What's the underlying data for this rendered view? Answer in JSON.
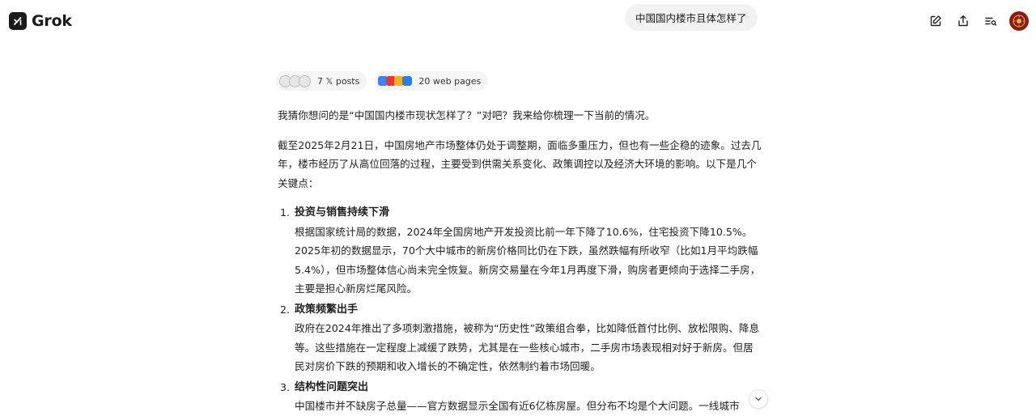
{
  "app": {
    "name": "Grok"
  },
  "query": {
    "text": "中国国内楼市且体怎样了"
  },
  "header": {
    "icons": [
      "new-chat-icon",
      "share-icon",
      "history-icon"
    ]
  },
  "sources": {
    "x_posts_label": "7 𝕏 posts",
    "web_pages_label": "20 web pages"
  },
  "answer": {
    "intro": "我猜你想问的是“中国国内楼市现状怎样了？”对吧？我来给你梳理一下当前的情况。",
    "overview": "截至2025年2月21日，中国房地产市场整体仍处于调整期，面临多重压力，但也有一些企稳的迹象。过去几年，楼市经历了从高位回落的过程，主要受到供需关系变化、政策调控以及经济大环境的影响。以下是几个关键点：",
    "points": [
      {
        "number": "1.",
        "title": "投资与销售持续下滑",
        "body": "根据国家统计局的数据，2024年全国房地产开发投资比前一年下降了10.6%，住宅投资下降10.5%。2025年初的数据显示，70个大中城市的新房价格同比仍在下跌，虽然跌幅有所收窄（比如1月平均跌幅5.4%），但市场整体信心尚未完全恢复。新房交易量在今年1月再度下滑，购房者更倾向于选择二手房，主要是担心新房烂尾风险。"
      },
      {
        "number": "2.",
        "title": "政策频繁出手",
        "body": "政府在2024年推出了多项刺激措施，被称为“历史性”政策组合拳，比如降低首付比例、放松限购、降息等。这些措施在一定程度上减缓了跌势，尤其是在一些核心城市，二手房市场表现相对好于新房。但居民对房价下跌的预期和收入增长的不确定性，依然制约着市场回暖。"
      },
      {
        "number": "3.",
        "title": "结构性问题突出",
        "body": "中国楼市并不缺房子总量——官方数据显示全国有近6亿栋房屋。但分布不均是个大问题。一线城市"
      }
    ]
  },
  "colors": {
    "accent": "#1b1b1b",
    "avatar": "#8a1c14",
    "bubble": "#f2f2f2"
  }
}
